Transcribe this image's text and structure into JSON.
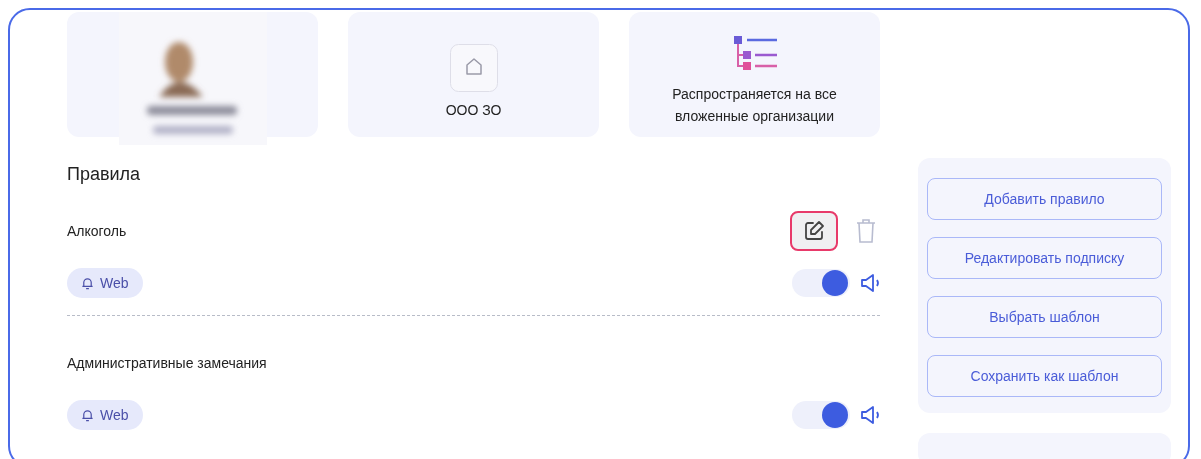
{
  "cards": [
    {
      "kind": "picture"
    },
    {
      "kind": "org",
      "label": "ООО ЗО"
    },
    {
      "kind": "scope",
      "label": "Распространяется на все вложенные организации"
    }
  ],
  "rules_title": "Правила",
  "rules": [
    {
      "name": "Алкоголь",
      "tag": "Web",
      "on": true,
      "hovered": true
    },
    {
      "name": "Административные замечания",
      "tag": "Web",
      "on": true
    }
  ],
  "actions": [
    "Добавить правило",
    "Редактировать подписку",
    "Выбрать шаблон",
    "Сохранить как шаблон"
  ]
}
